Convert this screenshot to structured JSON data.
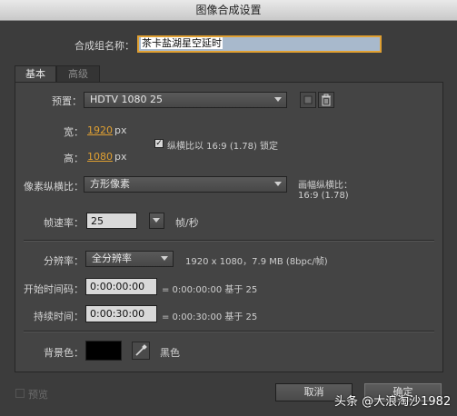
{
  "window": {
    "title": "图像合成设置"
  },
  "composition": {
    "name_label": "合成组名称：",
    "name_value": "茶卡盐湖星空延时"
  },
  "tabs": [
    {
      "label": "基本"
    },
    {
      "label": "高级"
    }
  ],
  "preset": {
    "label": "预置：",
    "value": "HDTV 1080 25"
  },
  "width": {
    "label": "宽：",
    "value": "1920",
    "unit": "px"
  },
  "height": {
    "label": "高：",
    "value": "1080",
    "unit": "px"
  },
  "aspect_lock": {
    "label": "纵横比以 16:9 (1.78) 锁定",
    "checked": true
  },
  "pixel_aspect": {
    "label": "像素纵横比：",
    "value": "方形像素",
    "frame_aspect_label": "画幅纵横比：",
    "frame_aspect_value": "16:9 (1.78)"
  },
  "frame_rate": {
    "label": "帧速率：",
    "value": "25",
    "unit": "帧/秒"
  },
  "resolution": {
    "label": "分辨率：",
    "value": "全分辨率",
    "info": "1920 x 1080，7.9 MB (8bpc/帧)"
  },
  "start_timecode": {
    "label": "开始时间码：",
    "value": "0:00:00:00",
    "info": "= 0:00:00:00  基于 25"
  },
  "duration": {
    "label": "持续时间：",
    "value": "0:00:30:00",
    "info": "= 0:00:30:00  基于 25"
  },
  "background": {
    "label": "背景色：",
    "color": "#000000",
    "name": "黑色"
  },
  "footer": {
    "preview_label": "预览",
    "cancel_label": "取消",
    "ok_label": "确定"
  },
  "watermark": "头条 @大浪淘沙1982",
  "icons": {
    "save": "save-preset-icon",
    "delete": "trash-icon",
    "eyedropper": "eyedropper-icon",
    "chevron": "chevron-down-icon"
  }
}
